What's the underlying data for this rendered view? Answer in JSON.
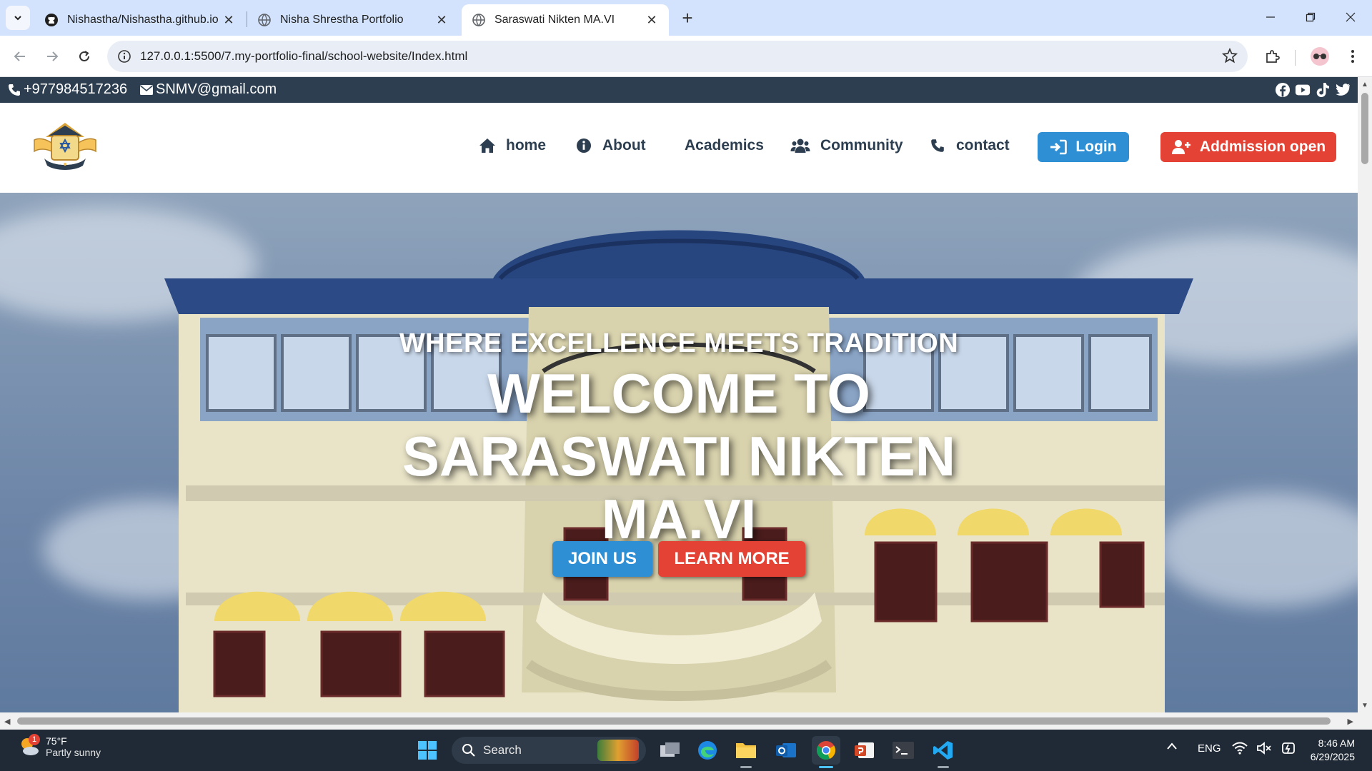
{
  "browser": {
    "tabs": [
      {
        "title": "Nishastha/Nishastha.github.io",
        "icon": "github-icon",
        "active": false
      },
      {
        "title": "Nisha Shrestha Portfolio",
        "icon": "globe-icon",
        "active": false
      },
      {
        "title": "Saraswati Nikten MA.VI",
        "icon": "globe-icon",
        "active": true
      }
    ],
    "url": "127.0.0.1:5500/7.my-portfolio-final/school-website/Index.html"
  },
  "page": {
    "topbar": {
      "phone": "+977984517236",
      "email": "SNMV@gmail.com",
      "socials": [
        "facebook-icon",
        "youtube-icon",
        "tiktok-icon",
        "twitter-icon"
      ]
    },
    "nav": {
      "home": "home",
      "about": "About",
      "academics": "Academics",
      "community": "Community",
      "contact": "contact",
      "login": "Login",
      "admission": "Addmission open"
    },
    "hero": {
      "tagline": "WHERE EXCELLENCE MEETS TRADITION",
      "headline": "WELCOME TO SARASWATI NIKTEN MA.VI",
      "join": "JOIN US",
      "learn": "LEARN MORE"
    },
    "colors": {
      "topbar": "#2c3e50",
      "primary": "#2e8fd4",
      "accent": "#e34234"
    }
  },
  "taskbar": {
    "weather_temp": "75°F",
    "weather_cond": "Partly sunny",
    "weather_badge": "1",
    "search": "Search",
    "lang": "ENG",
    "time": "8:46 AM",
    "date": "6/29/2025"
  }
}
